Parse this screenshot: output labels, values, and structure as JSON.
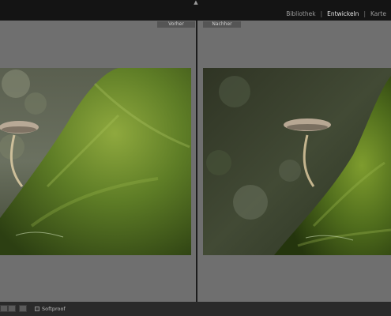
{
  "modules": {
    "items": [
      {
        "label": "Bibliothek",
        "active": false
      },
      {
        "label": "Entwickeln",
        "active": true
      },
      {
        "label": "Karte",
        "active": false
      }
    ]
  },
  "panes": {
    "before_label": "Vorher",
    "after_label": "Nachher"
  },
  "bottom": {
    "softproof_label": "Softproof",
    "softproof_checked": false
  },
  "colors": {
    "panel_bg": "#6f6f6f",
    "topbar_bg": "#141414",
    "bottombar_bg": "#2a2a2a",
    "active_module": "#e6e6e6"
  }
}
